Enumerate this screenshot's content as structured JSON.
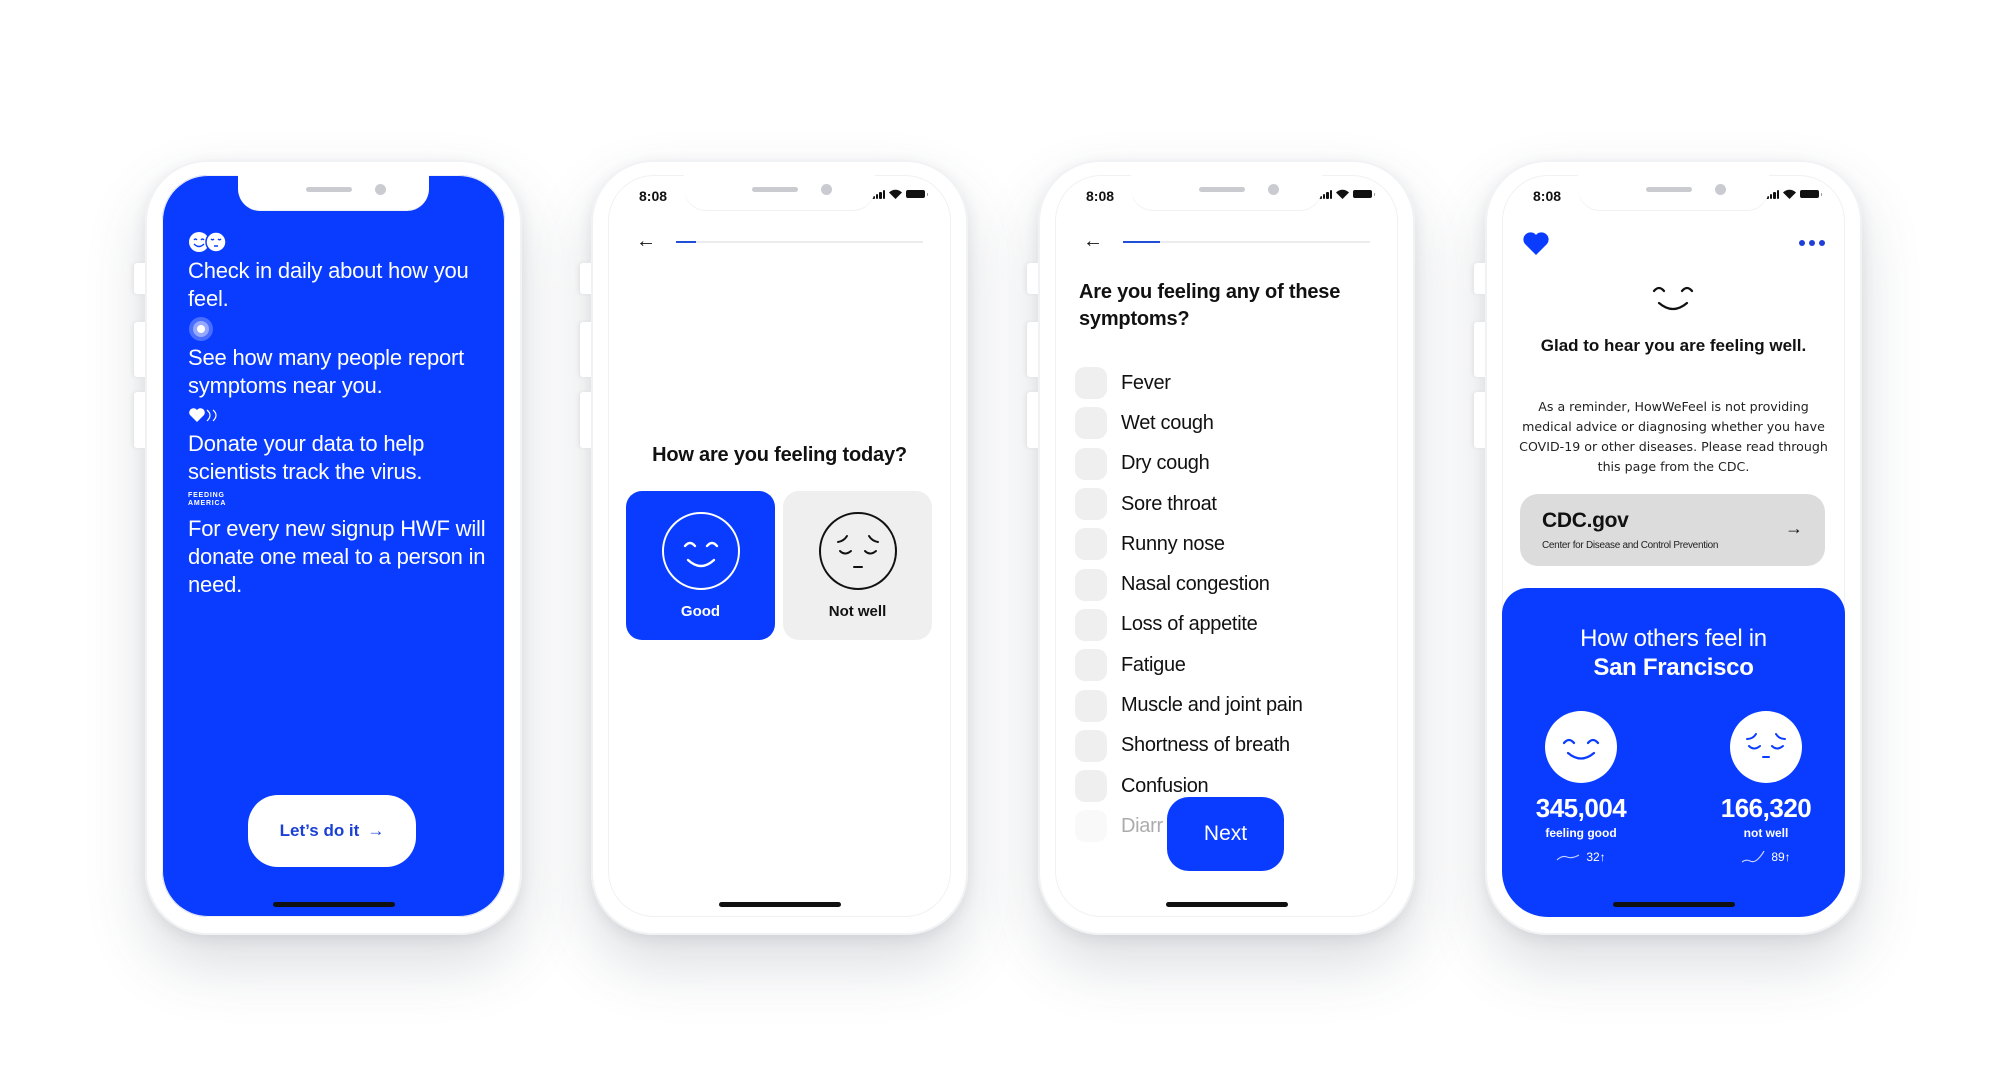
{
  "colors": {
    "brand_blue": "#0a3cff",
    "card_gray": "#efefef",
    "cdc_card_gray": "#dcdcdc"
  },
  "status_bar": {
    "time": "8:08",
    "icons": [
      "signal-icon",
      "wifi-icon",
      "battery-icon"
    ]
  },
  "onboarding": {
    "items": [
      {
        "icon": "mood-faces-icon",
        "text": "Check in daily about how you feel."
      },
      {
        "icon": "location-pulse-icon",
        "text": "See how many people report symptoms near you."
      },
      {
        "icon": "hearts-icon",
        "text": "Donate your data to help scientists track the virus."
      },
      {
        "icon": "feeding-america-logo",
        "logo_line1": "FEEDING",
        "logo_line2": "AMERICA",
        "text": "For every new signup HWF will donate one meal to a person in need."
      }
    ],
    "cta_label": "Let’s do it",
    "cta_icon": "arrow-right-icon"
  },
  "mood_check": {
    "progress_fraction": 0.08,
    "question": "How are you feeling today?",
    "options": [
      {
        "label": "Good",
        "selected": true,
        "icon": "smile-face-icon"
      },
      {
        "label": "Not well",
        "selected": false,
        "icon": "sad-face-icon"
      }
    ]
  },
  "symptoms": {
    "progress_fraction": 0.15,
    "question": "Are you feeling any of these symptoms?",
    "items": [
      "Fever",
      "Wet cough",
      "Dry cough",
      "Sore throat",
      "Runny nose",
      "Nasal congestion",
      "Loss of appetite",
      "Fatigue",
      "Muscle and joint pain",
      "Shortness of breath",
      "Confusion",
      "Diarr"
    ],
    "next_label": "Next"
  },
  "result": {
    "title": "Glad to hear you are feeling well.",
    "reminder": "As a reminder, HowWeFeel is not providing medical advice or diagnosing whether you have COVID-19 or other diseases. Please read through this page from the CDC.",
    "cdc_card": {
      "title": "CDC.gov",
      "subtitle": "Center for Disease and Control Prevention",
      "icon": "arrow-right-icon"
    },
    "panel": {
      "heading_line1": "How others feel in",
      "heading_line2": "San Francisco",
      "stats": [
        {
          "value": "345,004",
          "caption": "feeling good",
          "trend": "32↑",
          "icon": "smile-face-icon"
        },
        {
          "value": "166,320",
          "caption": "not well",
          "trend": "89↑",
          "icon": "sad-face-icon"
        }
      ]
    }
  }
}
